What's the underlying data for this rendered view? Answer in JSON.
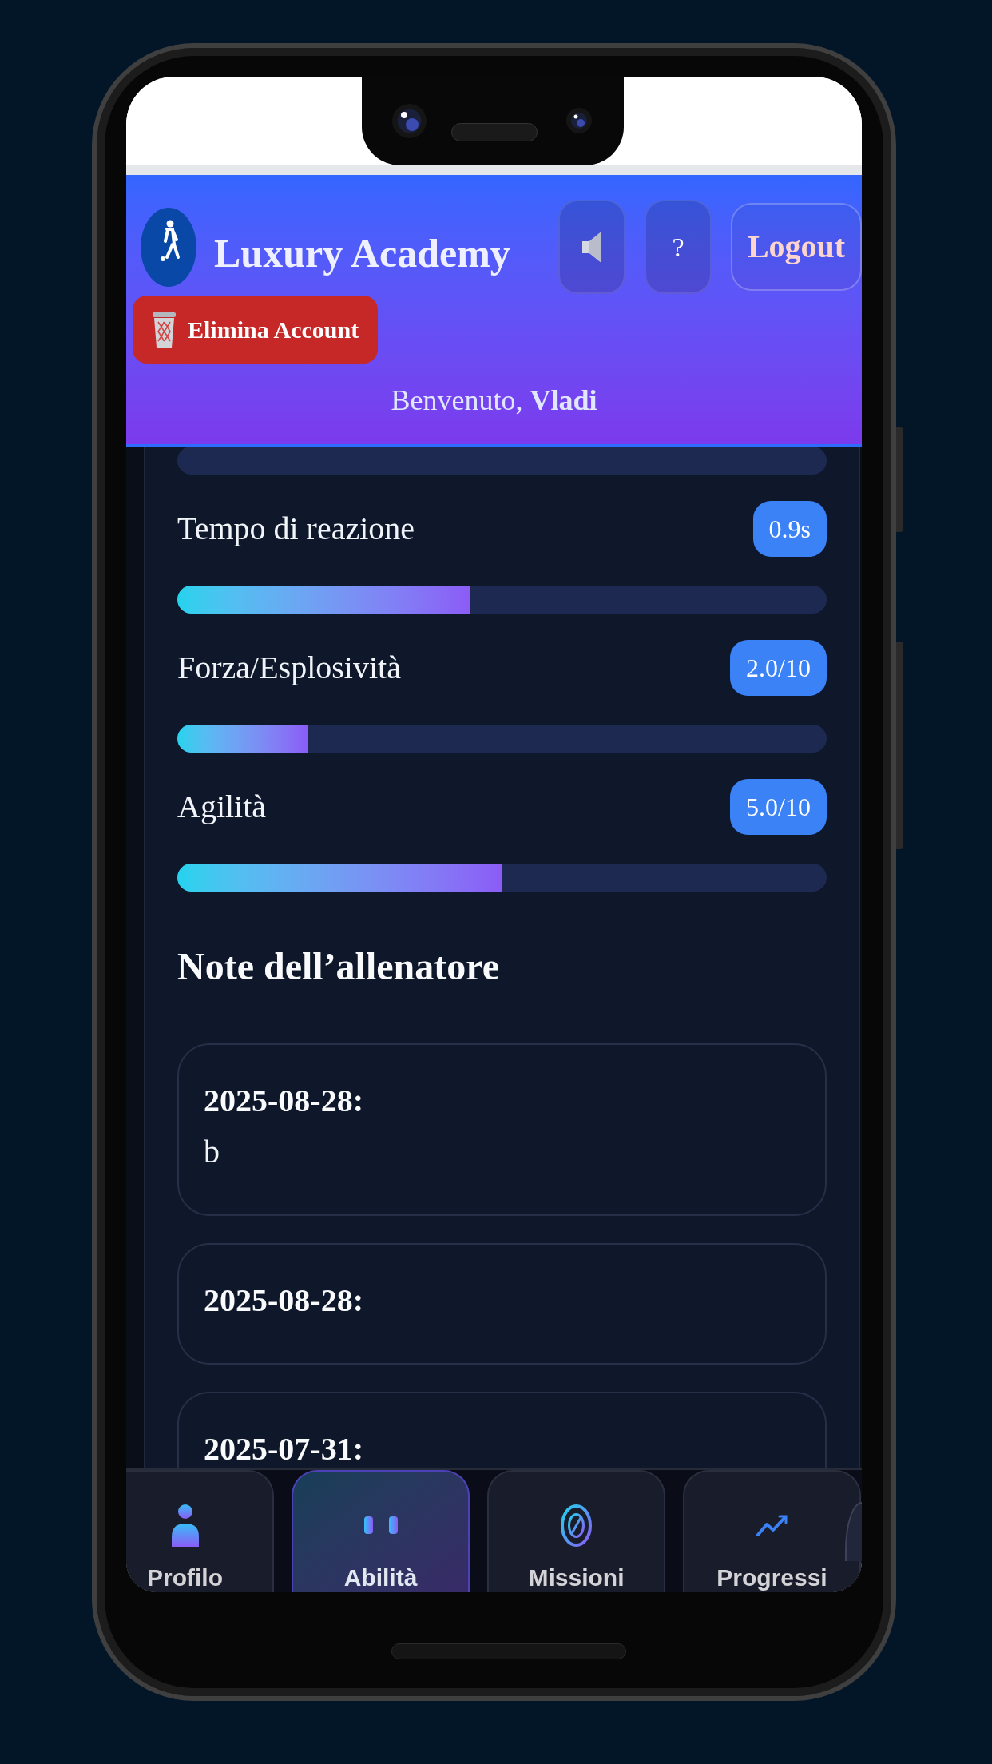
{
  "header": {
    "title": "Luxury Academy",
    "actions": [
      {
        "kind": "sound"
      },
      {
        "kind": "help",
        "label": "?"
      },
      {
        "kind": "logout",
        "label": "Logout"
      }
    ],
    "delete_button": {
      "label": "Elimina Account"
    },
    "greeting": "Benvenuto, **Vladi**"
  },
  "skills": [
    {
      "level": 0
    },
    {
      "label": "Tempo di reazione",
      "value": "0.9s",
      "level": 0.45
    },
    {
      "label": "Forza/Esplosività",
      "value": "2.0/10",
      "level": 0.2
    },
    {
      "label": "Agilità",
      "value": "5.0/10",
      "level": 0.5
    }
  ],
  "notes": {
    "title": "Note dell’allenatore",
    "items": [
      {
        "date": "2025-08-28:",
        "text": "b"
      },
      {
        "date": "2025-08-28:"
      },
      {
        "date": "2025-07-31:"
      }
    ]
  },
  "nav": [
    {
      "label": "Profilo",
      "selected": false
    },
    {
      "label": "Abilità",
      "selected": true
    },
    {
      "label": "Missioni",
      "selected": false
    },
    {
      "label": "Progressi",
      "selected": false
    }
  ]
}
